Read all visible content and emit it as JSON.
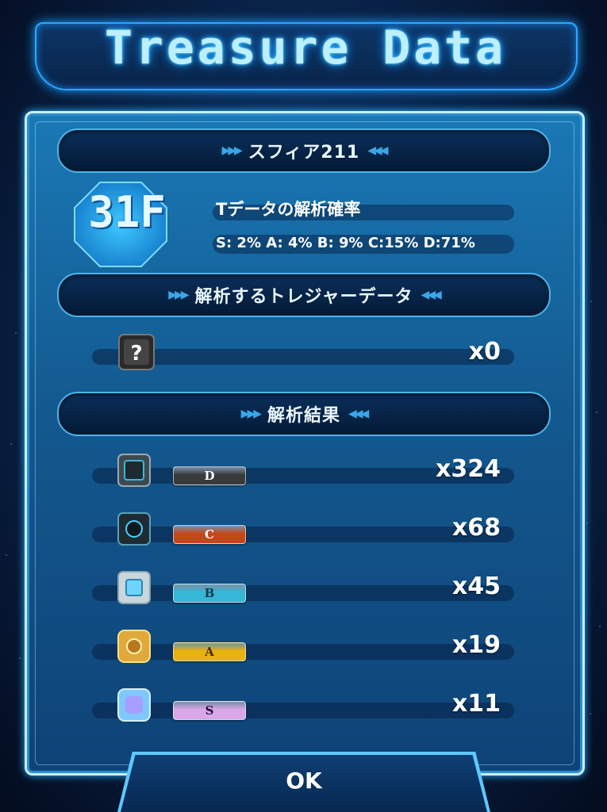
{
  "title": "Treasure Data",
  "sphere_header": "スフィア211",
  "floor": "31F",
  "analysis_rate": {
    "label": "Tデータの解析確率",
    "values": "S: 2% A: 4% B: 9% C:15% D:71%"
  },
  "analyze_header": "解析するトレジャーデータ",
  "unknown_item": {
    "count": "x0",
    "icon": "mystery-cube-icon"
  },
  "result_header": "解析結果",
  "results": [
    {
      "grade": "D",
      "count": "x324",
      "color": "#3a3a3a",
      "text_color": "#ffffff"
    },
    {
      "grade": "C",
      "count": "x68",
      "color": "#c4471a",
      "text_color": "#ffffff"
    },
    {
      "grade": "B",
      "count": "x45",
      "color": "#35b7d6",
      "text_color": "#10364a"
    },
    {
      "grade": "A",
      "count": "x19",
      "color": "#e8b20f",
      "text_color": "#4a2e00"
    },
    {
      "grade": "S",
      "count": "x11",
      "color": "#d9a7e8",
      "text_color": "#2a1040"
    }
  ],
  "ok_button": "OK",
  "colors": {
    "panel": "#1a79b6",
    "glow": "#2ec8ff",
    "section_bar": "#0a2f5a"
  }
}
